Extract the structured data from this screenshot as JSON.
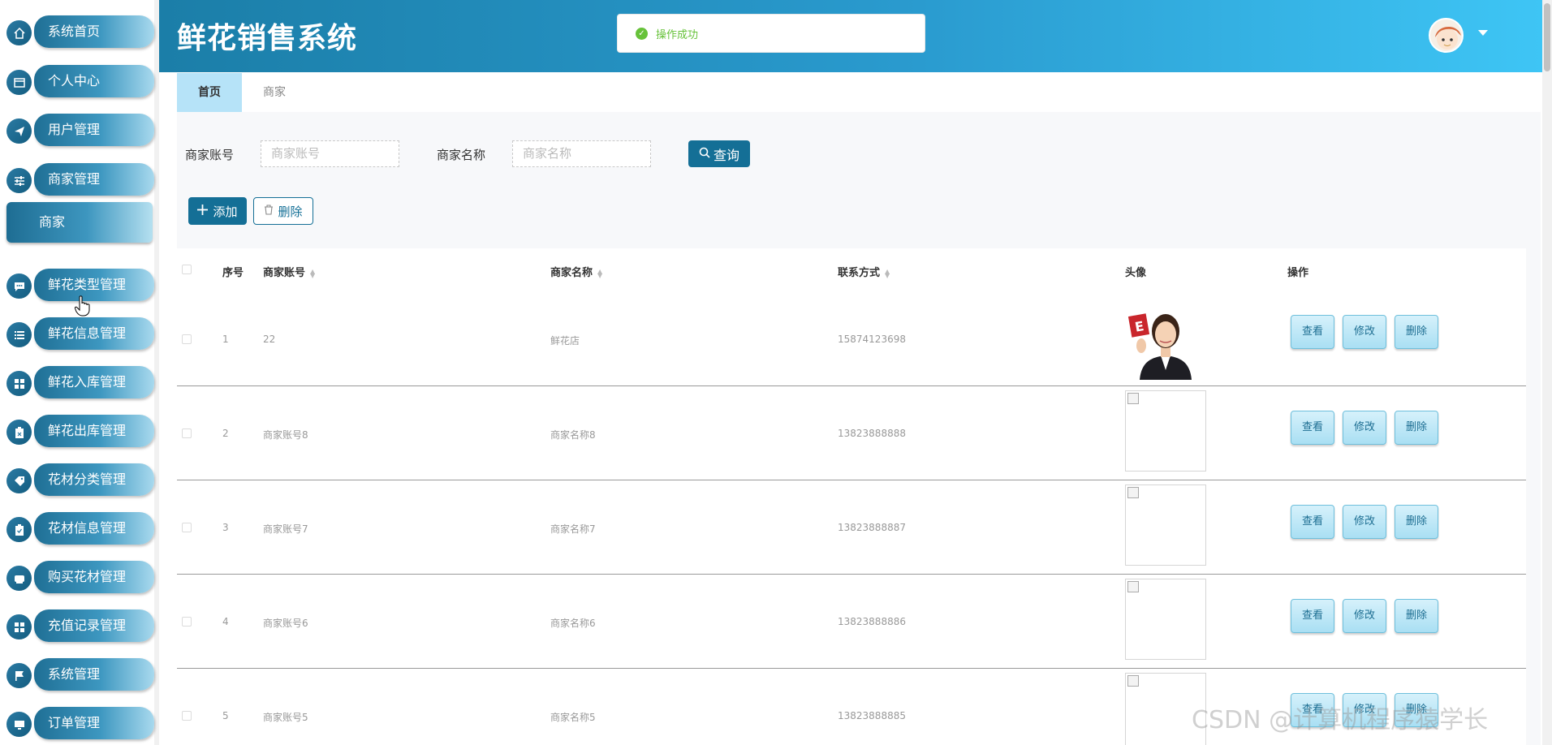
{
  "app": {
    "title": "鲜花销售系统"
  },
  "toast": {
    "message": "操作成功"
  },
  "sidebar": {
    "items": [
      {
        "label": "系统首页",
        "icon": "home-icon"
      },
      {
        "label": "个人中心",
        "icon": "window-icon"
      },
      {
        "label": "用户管理",
        "icon": "send-icon"
      },
      {
        "label": "商家管理",
        "icon": "sliders-icon"
      },
      {
        "label": "鲜花类型管理",
        "icon": "chat-icon"
      },
      {
        "label": "鲜花信息管理",
        "icon": "list-icon"
      },
      {
        "label": "鲜花入库管理",
        "icon": "grid-icon"
      },
      {
        "label": "鲜花出库管理",
        "icon": "clipboard-icon"
      },
      {
        "label": "花材分类管理",
        "icon": "tag-icon"
      },
      {
        "label": "花材信息管理",
        "icon": "clipboard-check-icon"
      },
      {
        "label": "购买花材管理",
        "icon": "cart-icon"
      },
      {
        "label": "充值记录管理",
        "icon": "grid-icon"
      },
      {
        "label": "系统管理",
        "icon": "flag-icon"
      },
      {
        "label": "订单管理",
        "icon": "monitor-icon"
      }
    ],
    "submenu": {
      "label": "商家"
    }
  },
  "tabs": {
    "home": "首页",
    "merchant": "商家"
  },
  "search": {
    "account_label": "商家账号",
    "account_placeholder": "商家账号",
    "name_label": "商家名称",
    "name_placeholder": "商家名称",
    "query_label": "查询"
  },
  "actions": {
    "add_label": "添加",
    "delete_label": "删除"
  },
  "table": {
    "headers": {
      "index": "序号",
      "account": "商家账号",
      "name": "商家名称",
      "phone": "联系方式",
      "avatar": "头像",
      "ops": "操作"
    },
    "op_labels": {
      "view": "查看",
      "edit": "修改",
      "delete": "删除"
    },
    "rows": [
      {
        "index": "1",
        "account": "22",
        "name": "鲜花店",
        "phone": "15874123698"
      },
      {
        "index": "2",
        "account": "商家账号8",
        "name": "商家名称8",
        "phone": "13823888888"
      },
      {
        "index": "3",
        "account": "商家账号7",
        "name": "商家名称7",
        "phone": "13823888887"
      },
      {
        "index": "4",
        "account": "商家账号6",
        "name": "商家名称6",
        "phone": "13823888886"
      },
      {
        "index": "5",
        "account": "商家账号5",
        "name": "商家名称5",
        "phone": "13823888885"
      }
    ]
  },
  "watermark": "CSDN @计算机程序猿学长",
  "colors": {
    "primary": "#146f96",
    "header_start": "#1b7ea8",
    "header_end": "#3ec5f5",
    "success": "#67c23a"
  }
}
